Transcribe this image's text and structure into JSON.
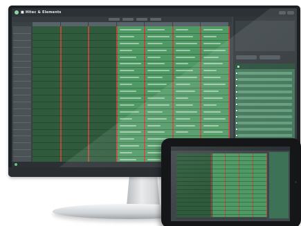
{
  "scene": {
    "devices": [
      "monitor",
      "tablet"
    ]
  },
  "app": {
    "title": "■ Hitec & Elements",
    "subtitle": "",
    "colors": {
      "dark_column": "#2f5b3c",
      "light_column": "#4f9a64",
      "separator": "#b84b3e",
      "panel_green": "#3e7256",
      "background": "#3d4347"
    }
  },
  "toolbar": {
    "buttons": [
      "",
      "",
      "",
      ""
    ]
  },
  "grid": {
    "columns": [
      {
        "label": "",
        "shade": "dark"
      },
      {
        "label": "",
        "shade": "dark"
      },
      {
        "label": "",
        "shade": "dark"
      },
      {
        "label": "",
        "shade": "light"
      },
      {
        "label": "",
        "shade": "light"
      },
      {
        "label": "",
        "shade": "light"
      },
      {
        "label": "",
        "shade": "light"
      }
    ],
    "rows": 20
  },
  "side_panel": {
    "buttons": [
      "",
      ""
    ],
    "list_title": "",
    "list_items": 14
  },
  "statusbar": {
    "left_text": "",
    "right_text": ""
  }
}
